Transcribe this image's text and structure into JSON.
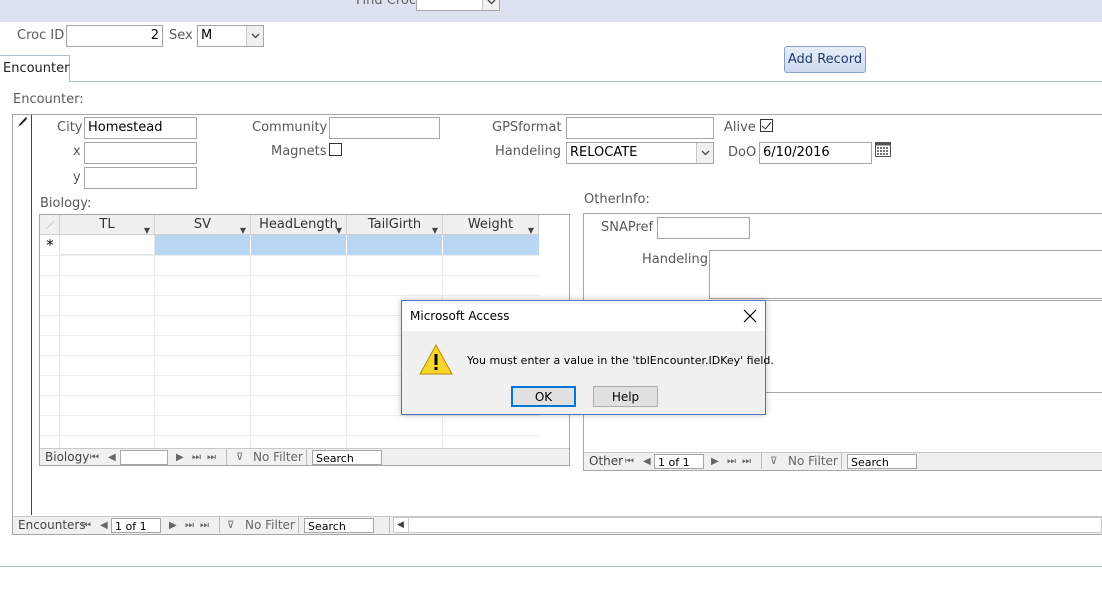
{
  "header": {
    "find_label": "Find Croc",
    "find_value": ""
  },
  "main": {
    "croc_id_label": "Croc ID",
    "croc_id_value": "2",
    "sex_label": "Sex",
    "sex_value": "M",
    "add_record_label": "Add Record",
    "tab_label": "Encounter",
    "section_label": "Encounter:"
  },
  "encounter": {
    "city_label": "City",
    "city_value": "Homestead",
    "x_label": "x",
    "x_value": "",
    "y_label": "y",
    "y_value": "",
    "community_label": "Community",
    "community_value": "",
    "magnets_label": "Magnets",
    "gpsformat_label": "GPSformat",
    "gpsformat_value": "",
    "handeling_label": "Handeling",
    "handeling_value": "RELOCATE",
    "alive_label": "Alive",
    "doo_label": "DoO",
    "doo_value": "6/10/2016"
  },
  "biology": {
    "label": "Biology:",
    "columns": [
      "TL",
      "SV",
      "HeadLength",
      "TailGirth",
      "Weight"
    ],
    "new_row_marker": "*",
    "nav_label": "Biology",
    "record": "",
    "filter": "No Filter",
    "search": "Search"
  },
  "other": {
    "label": "OtherInfo:",
    "snapref_label": "SNAPref",
    "snapref_value": "",
    "handeling_label": "Handeling",
    "nav_label": "Other",
    "record": "1 of 1",
    "filter": "No Filter",
    "search": "Search"
  },
  "encounters_nav": {
    "nav_label": "Encounters",
    "record": "1 of 1",
    "filter": "No Filter",
    "search": "Search"
  },
  "dialog": {
    "title": "Microsoft Access",
    "message": "You must enter a value in the 'tblEncounter.IDKey' field.",
    "ok_label": "OK",
    "help_label": "Help"
  },
  "colors": {
    "top_band": "#dde3ee",
    "accent_line": "#a9bfd0",
    "selection": "#b9d6f2"
  }
}
